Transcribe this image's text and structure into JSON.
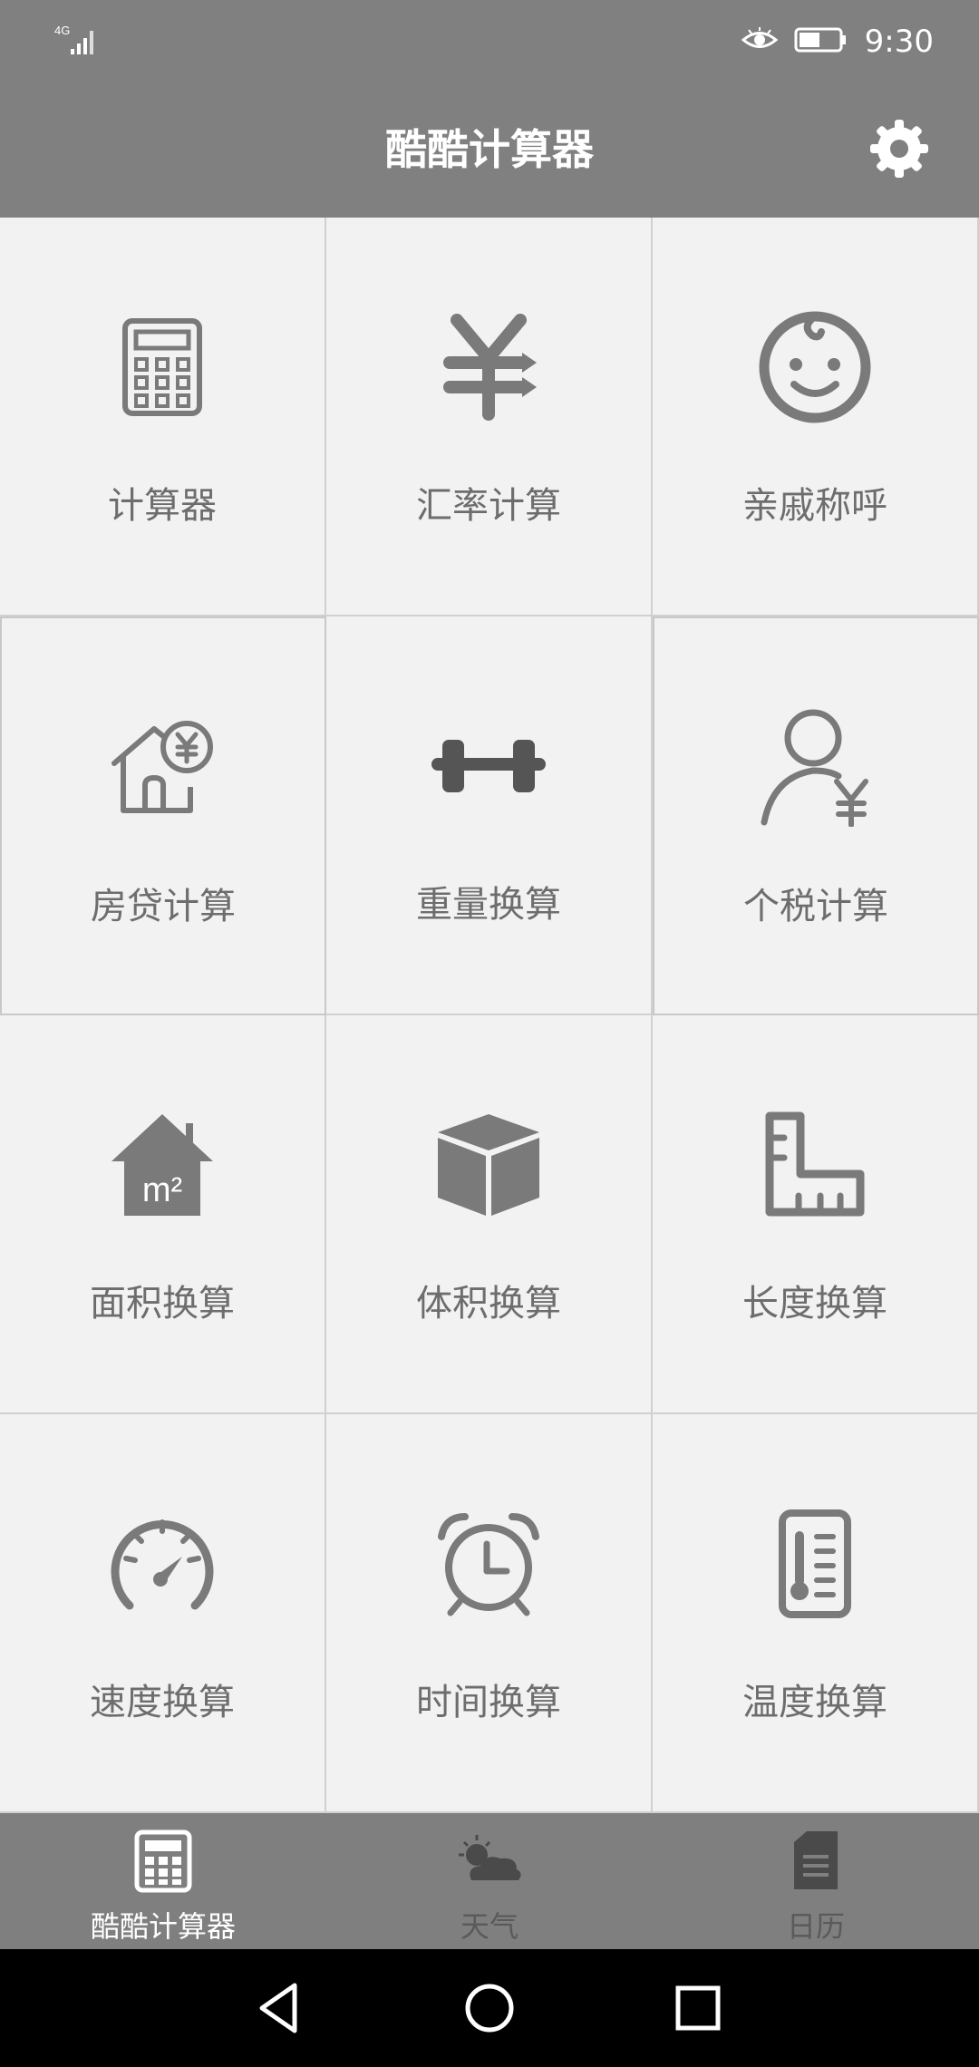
{
  "status_bar": {
    "network": "4G",
    "time": "9:30",
    "icons": [
      "signal-icon",
      "eye-icon",
      "battery-icon"
    ]
  },
  "app_bar": {
    "title": "酷酷计算器",
    "settings_icon": "gear-icon"
  },
  "grid": {
    "items": [
      {
        "label": "计算器",
        "icon": "calculator-icon"
      },
      {
        "label": "汇率计算",
        "icon": "yuan-exchange-icon"
      },
      {
        "label": "亲戚称呼",
        "icon": "baby-face-icon"
      },
      {
        "label": "房贷计算",
        "icon": "house-yuan-icon"
      },
      {
        "label": "重量换算",
        "icon": "dumbbell-icon"
      },
      {
        "label": "个税计算",
        "icon": "person-yuan-icon"
      },
      {
        "label": "面积换算",
        "icon": "house-m2-icon"
      },
      {
        "label": "体积换算",
        "icon": "cube-icon"
      },
      {
        "label": "长度换算",
        "icon": "ruler-icon"
      },
      {
        "label": "速度换算",
        "icon": "speedometer-icon"
      },
      {
        "label": "时间换算",
        "icon": "alarm-clock-icon"
      },
      {
        "label": "温度换算",
        "icon": "thermometer-icon"
      }
    ],
    "m2_text": "m²"
  },
  "tab_bar": {
    "tabs": [
      {
        "label": "酷酷计算器",
        "icon": "calculator-tab-icon",
        "active": true
      },
      {
        "label": "天气",
        "icon": "weather-icon",
        "active": false
      },
      {
        "label": "日历",
        "icon": "calendar-icon",
        "active": false
      }
    ],
    "active_color": "#ffffff",
    "inactive_color": "#5a5a5a"
  },
  "nav_bar": {
    "buttons": [
      "back-icon",
      "home-icon",
      "recents-icon"
    ]
  }
}
